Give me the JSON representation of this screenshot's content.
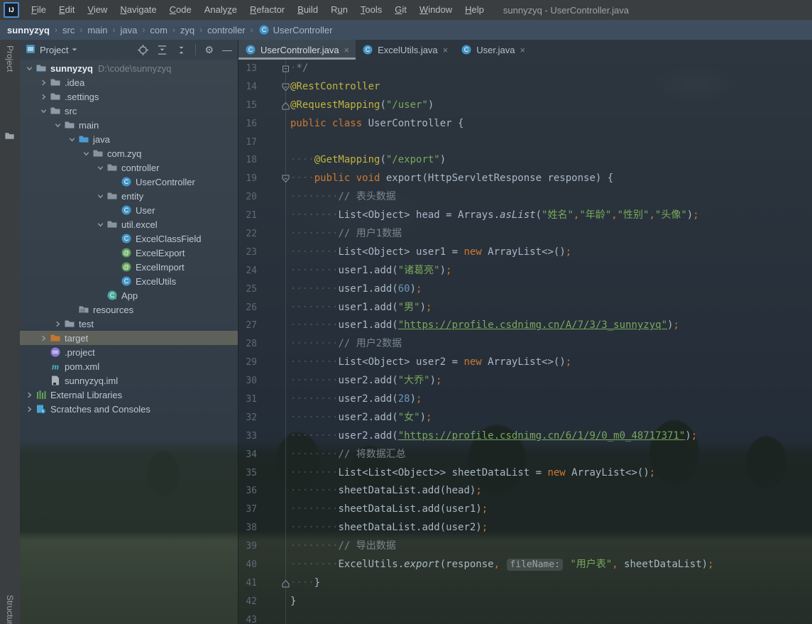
{
  "window": {
    "title": "sunnyzyq - UserController.java",
    "logo": "IJ",
    "menus": [
      {
        "label": "File",
        "u": 0
      },
      {
        "label": "Edit",
        "u": 0
      },
      {
        "label": "View",
        "u": 0
      },
      {
        "label": "Navigate",
        "u": 0
      },
      {
        "label": "Code",
        "u": 0
      },
      {
        "label": "Analyze",
        "u": 5
      },
      {
        "label": "Refactor",
        "u": 0
      },
      {
        "label": "Build",
        "u": 0
      },
      {
        "label": "Run",
        "u": 1
      },
      {
        "label": "Tools",
        "u": 0
      },
      {
        "label": "Git",
        "u": 0
      },
      {
        "label": "Window",
        "u": 0
      },
      {
        "label": "Help",
        "u": 0
      }
    ]
  },
  "breadcrumbs": [
    {
      "label": "sunnyzyq",
      "icon": "none"
    },
    {
      "label": "src",
      "icon": "none"
    },
    {
      "label": "main",
      "icon": "none"
    },
    {
      "label": "java",
      "icon": "none"
    },
    {
      "label": "com",
      "icon": "none"
    },
    {
      "label": "zyq",
      "icon": "none"
    },
    {
      "label": "controller",
      "icon": "none"
    },
    {
      "label": "UserController",
      "icon": "class"
    }
  ],
  "tool_stripe": {
    "top_label": "Project",
    "bottom_label": "Structure"
  },
  "project_panel": {
    "header": {
      "title": "Project",
      "icons": [
        "locate",
        "expand-all",
        "collapse-all",
        "settings",
        "hide"
      ]
    },
    "tree": [
      {
        "label": "sunnyzyq",
        "suffix": "D:\\code\\sunnyzyq",
        "level": 0,
        "chevron": "down",
        "icon": "project-folder",
        "bold": true,
        "selected": false
      },
      {
        "label": ".idea",
        "level": 1,
        "chevron": "right",
        "icon": "folder",
        "selected": false
      },
      {
        "label": ".settings",
        "level": 1,
        "chevron": "right",
        "icon": "folder",
        "selected": false
      },
      {
        "label": "src",
        "level": 1,
        "chevron": "down",
        "icon": "folder",
        "selected": false
      },
      {
        "label": "main",
        "level": 2,
        "chevron": "down",
        "icon": "folder",
        "selected": false
      },
      {
        "label": "java",
        "level": 3,
        "chevron": "down",
        "icon": "source-folder",
        "selected": false
      },
      {
        "label": "com.zyq",
        "level": 4,
        "chevron": "down",
        "icon": "package",
        "selected": false
      },
      {
        "label": "controller",
        "level": 5,
        "chevron": "down",
        "icon": "package",
        "selected": false
      },
      {
        "label": "UserController",
        "level": 6,
        "chevron": "none",
        "icon": "class",
        "selected": false
      },
      {
        "label": "entity",
        "level": 5,
        "chevron": "down",
        "icon": "package",
        "selected": false
      },
      {
        "label": "User",
        "level": 6,
        "chevron": "none",
        "icon": "class",
        "selected": false
      },
      {
        "label": "util.excel",
        "level": 5,
        "chevron": "down",
        "icon": "package",
        "selected": false
      },
      {
        "label": "ExcelClassField",
        "level": 6,
        "chevron": "none",
        "icon": "class",
        "selected": false
      },
      {
        "label": "ExcelExport",
        "level": 6,
        "chevron": "none",
        "icon": "annotation",
        "selected": false
      },
      {
        "label": "ExcelImport",
        "level": 6,
        "chevron": "none",
        "icon": "annotation",
        "selected": false
      },
      {
        "label": "ExcelUtils",
        "level": 6,
        "chevron": "none",
        "icon": "class",
        "selected": false
      },
      {
        "label": "App",
        "level": 5,
        "chevron": "none",
        "icon": "runnable-class",
        "selected": false
      },
      {
        "label": "resources",
        "level": 3,
        "chevron": "none",
        "icon": "resources-folder",
        "selected": false
      },
      {
        "label": "test",
        "level": 2,
        "chevron": "right",
        "icon": "folder",
        "selected": false
      },
      {
        "label": "target",
        "level": 1,
        "chevron": "right",
        "icon": "excluded-folder",
        "selected": true
      },
      {
        "label": ".project",
        "level": 1,
        "chevron": "none",
        "icon": "eclipse-file",
        "selected": false
      },
      {
        "label": "pom.xml",
        "level": 1,
        "chevron": "none",
        "icon": "maven-file",
        "selected": false
      },
      {
        "label": "sunnyzyq.iml",
        "level": 1,
        "chevron": "none",
        "icon": "iml-file",
        "selected": false
      },
      {
        "label": "External Libraries",
        "level": 0,
        "chevron": "right",
        "icon": "libraries",
        "selected": false
      },
      {
        "label": "Scratches and Consoles",
        "level": 0,
        "chevron": "right",
        "icon": "scratches",
        "selected": false
      }
    ]
  },
  "editor": {
    "tabs": [
      {
        "label": "UserController.java",
        "icon": "class",
        "close": "×",
        "active": true
      },
      {
        "label": "ExcelUtils.java",
        "icon": "class",
        "close": "×",
        "active": false
      },
      {
        "label": "User.java",
        "icon": "class",
        "close": "×",
        "active": false
      }
    ],
    "lines": [
      {
        "n": 13,
        "fold": "box",
        "t": [
          [
            "ws",
            1
          ],
          [
            "c",
            "*/"
          ]
        ]
      },
      {
        "n": 14,
        "fold": "down",
        "t": [
          [
            "a",
            "@RestController"
          ]
        ]
      },
      {
        "n": 15,
        "fold": "up",
        "t": [
          [
            "a",
            "@RequestMapping"
          ],
          [
            "p",
            "("
          ],
          [
            "s",
            "\"/user\""
          ],
          [
            "p",
            ")"
          ]
        ]
      },
      {
        "n": 16,
        "fold": "none",
        "t": [
          [
            "k",
            "public class "
          ],
          [
            "p",
            "UserController {"
          ]
        ]
      },
      {
        "n": 17,
        "fold": "none",
        "t": []
      },
      {
        "n": 18,
        "fold": "none",
        "t": [
          [
            "ws",
            4
          ],
          [
            "a",
            "@GetMapping"
          ],
          [
            "p",
            "("
          ],
          [
            "s",
            "\"/export\""
          ],
          [
            "p",
            ")"
          ]
        ]
      },
      {
        "n": 19,
        "fold": "down",
        "t": [
          [
            "ws",
            4
          ],
          [
            "k",
            "public void "
          ],
          [
            "p",
            "export(HttpServletResponse response) {"
          ]
        ]
      },
      {
        "n": 20,
        "fold": "none",
        "t": [
          [
            "ws",
            8
          ],
          [
            "c",
            "// 表头数据"
          ]
        ]
      },
      {
        "n": 21,
        "fold": "none",
        "t": [
          [
            "ws",
            8
          ],
          [
            "p",
            "List<Object> head = Arrays."
          ],
          [
            "i",
            "asList"
          ],
          [
            "p",
            "("
          ],
          [
            "s",
            "\"姓名\""
          ],
          [
            "k",
            ","
          ],
          [
            "s",
            "\"年龄\""
          ],
          [
            "k",
            ","
          ],
          [
            "s",
            "\"性别\""
          ],
          [
            "k",
            ","
          ],
          [
            "s",
            "\"头像\""
          ],
          [
            "p",
            ")"
          ],
          [
            "k",
            ";"
          ]
        ]
      },
      {
        "n": 22,
        "fold": "none",
        "t": [
          [
            "ws",
            8
          ],
          [
            "c",
            "// 用户1数据"
          ]
        ]
      },
      {
        "n": 23,
        "fold": "none",
        "t": [
          [
            "ws",
            8
          ],
          [
            "p",
            "List<Object> user1 = "
          ],
          [
            "k",
            "new "
          ],
          [
            "p",
            "ArrayList<>()"
          ],
          [
            "k",
            ";"
          ]
        ]
      },
      {
        "n": 24,
        "fold": "none",
        "t": [
          [
            "ws",
            8
          ],
          [
            "p",
            "user1.add("
          ],
          [
            "s",
            "\"诸葛亮\""
          ],
          [
            "p",
            ")"
          ],
          [
            "k",
            ";"
          ]
        ]
      },
      {
        "n": 25,
        "fold": "none",
        "t": [
          [
            "ws",
            8
          ],
          [
            "p",
            "user1.add("
          ],
          [
            "n",
            "60"
          ],
          [
            "p",
            ")"
          ],
          [
            "k",
            ";"
          ]
        ]
      },
      {
        "n": 26,
        "fold": "none",
        "t": [
          [
            "ws",
            8
          ],
          [
            "p",
            "user1.add("
          ],
          [
            "s",
            "\"男\""
          ],
          [
            "p",
            ")"
          ],
          [
            "k",
            ";"
          ]
        ]
      },
      {
        "n": 27,
        "fold": "none",
        "t": [
          [
            "ws",
            8
          ],
          [
            "p",
            "user1.add("
          ],
          [
            "u",
            "\"https://profile.csdnimg.cn/A/7/3/3_sunnyzyq\""
          ],
          [
            "p",
            ")"
          ],
          [
            "k",
            ";"
          ]
        ]
      },
      {
        "n": 28,
        "fold": "none",
        "t": [
          [
            "ws",
            8
          ],
          [
            "c",
            "// 用户2数据"
          ]
        ]
      },
      {
        "n": 29,
        "fold": "none",
        "t": [
          [
            "ws",
            8
          ],
          [
            "p",
            "List<Object> user2 = "
          ],
          [
            "k",
            "new "
          ],
          [
            "p",
            "ArrayList<>()"
          ],
          [
            "k",
            ";"
          ]
        ]
      },
      {
        "n": 30,
        "fold": "none",
        "t": [
          [
            "ws",
            8
          ],
          [
            "p",
            "user2.add("
          ],
          [
            "s",
            "\"大乔\""
          ],
          [
            "p",
            ")"
          ],
          [
            "k",
            ";"
          ]
        ]
      },
      {
        "n": 31,
        "fold": "none",
        "t": [
          [
            "ws",
            8
          ],
          [
            "p",
            "user2.add("
          ],
          [
            "n",
            "28"
          ],
          [
            "p",
            ")"
          ],
          [
            "k",
            ";"
          ]
        ]
      },
      {
        "n": 32,
        "fold": "none",
        "t": [
          [
            "ws",
            8
          ],
          [
            "p",
            "user2.add("
          ],
          [
            "s",
            "\"女\""
          ],
          [
            "p",
            ")"
          ],
          [
            "k",
            ";"
          ]
        ]
      },
      {
        "n": 33,
        "fold": "none",
        "t": [
          [
            "ws",
            8
          ],
          [
            "p",
            "user2.add("
          ],
          [
            "u",
            "\"https://profile.csdnimg.cn/6/1/9/0_m0_48717371\""
          ],
          [
            "p",
            ")"
          ],
          [
            "k",
            ";"
          ]
        ]
      },
      {
        "n": 34,
        "fold": "none",
        "t": [
          [
            "ws",
            8
          ],
          [
            "c",
            "// 将数据汇总"
          ]
        ]
      },
      {
        "n": 35,
        "fold": "none",
        "t": [
          [
            "ws",
            8
          ],
          [
            "p",
            "List<List<Object>> sheetDataList = "
          ],
          [
            "k",
            "new "
          ],
          [
            "p",
            "ArrayList<>()"
          ],
          [
            "k",
            ";"
          ]
        ]
      },
      {
        "n": 36,
        "fold": "none",
        "t": [
          [
            "ws",
            8
          ],
          [
            "p",
            "sheetDataList.add(head)"
          ],
          [
            "k",
            ";"
          ]
        ]
      },
      {
        "n": 37,
        "fold": "none",
        "t": [
          [
            "ws",
            8
          ],
          [
            "p",
            "sheetDataList.add(user1)"
          ],
          [
            "k",
            ";"
          ]
        ]
      },
      {
        "n": 38,
        "fold": "none",
        "t": [
          [
            "ws",
            8
          ],
          [
            "p",
            "sheetDataList.add(user2)"
          ],
          [
            "k",
            ";"
          ]
        ]
      },
      {
        "n": 39,
        "fold": "none",
        "t": [
          [
            "ws",
            8
          ],
          [
            "c",
            "// 导出数据"
          ]
        ]
      },
      {
        "n": 40,
        "fold": "none",
        "t": [
          [
            "ws",
            8
          ],
          [
            "p",
            "ExcelUtils."
          ],
          [
            "i",
            "export"
          ],
          [
            "p",
            "(response"
          ],
          [
            "k",
            ", "
          ],
          [
            "h",
            "fileName:"
          ],
          [
            "s",
            " \"用户表\""
          ],
          [
            "k",
            ", "
          ],
          [
            "p",
            "sheetDataList)"
          ],
          [
            "k",
            ";"
          ]
        ]
      },
      {
        "n": 41,
        "fold": "up",
        "t": [
          [
            "ws",
            4
          ],
          [
            "p",
            "}"
          ]
        ]
      },
      {
        "n": 42,
        "fold": "none",
        "t": [
          [
            "p",
            "}"
          ]
        ]
      },
      {
        "n": 43,
        "fold": "none",
        "t": []
      }
    ]
  },
  "colors": {
    "keyword_orange": "#cc7832",
    "annotation_yellow": "#bfb43d",
    "string_green": "#79a85b",
    "number_blue": "#6897bb",
    "comment_gray": "#7a858f",
    "selection_tan": "rgba(197,178,126,0.30)",
    "breadcrumb_bg": "#3c4c5e",
    "menubar_bg": "#3b3e40"
  }
}
